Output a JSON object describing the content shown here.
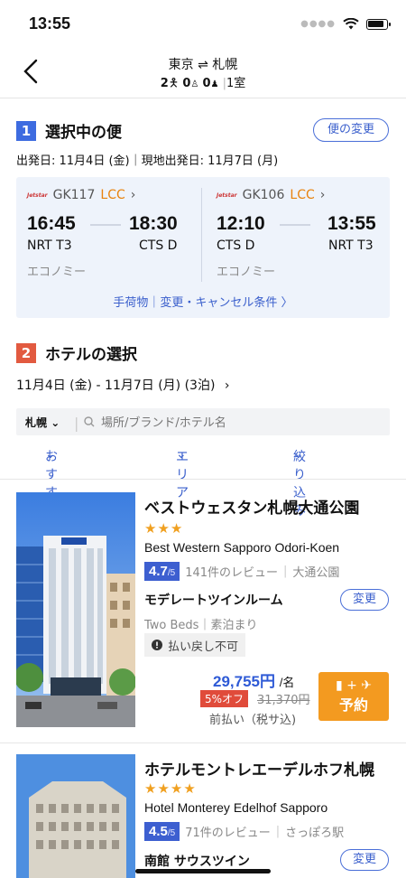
{
  "status": {
    "time": "13:55"
  },
  "header": {
    "route": "東京 ⇌ 札幌",
    "adults": "2",
    "children": "0",
    "infants": "0",
    "rooms": "1室"
  },
  "flights_section": {
    "number": "1",
    "title": "選択中の便",
    "change_label": "便の変更",
    "dates": "出発日: 11月4日 (金)｜現地出発日: 11月7日 (月)",
    "legs": [
      {
        "airline_logo": "Jetstar",
        "flight": "GK117",
        "type": "LCC",
        "dep_time": "16:45",
        "arr_time": "18:30",
        "dep_port": "NRT T3",
        "arr_port": "CTS D",
        "cabin": "エコノミー"
      },
      {
        "airline_logo": "Jetstar",
        "flight": "GK106",
        "type": "LCC",
        "dep_time": "12:10",
        "arr_time": "13:55",
        "dep_port": "CTS D",
        "arr_port": "NRT T3",
        "cabin": "エコノミー"
      }
    ],
    "conditions_link": "手荷物｜変更・キャンセル条件 〉"
  },
  "hotel_section": {
    "number": "2",
    "title": "ホテルの選択",
    "stay_dates": "11月4日 (金) - 11月7日 (月) (3泊)",
    "city": "札幌",
    "search_placeholder": "場所/ブランド/ホテル名",
    "sort": {
      "recommended": "おすすめ",
      "area": "エリア",
      "filter": "絞り込み"
    }
  },
  "hotels": [
    {
      "name": "ベストウェスタン札幌大通公園",
      "stars": "★★★",
      "name_en": "Best Western Sapporo Odori-Koen",
      "score": "4.7",
      "score_max": "/5",
      "reviews": "141件のレビュー",
      "area": "大通公園",
      "room": "モデレートツインルーム",
      "change_label": "変更",
      "room_detail": "Two Beds｜素泊まり",
      "refund": "払い戻し不可",
      "price": "29,755円",
      "price_unit": "/名",
      "discount": "5%オフ",
      "old_price": "31,370円",
      "tax_note": "前払い（税サ込)",
      "book_label": "予約"
    },
    {
      "name": "ホテルモントレエーデルホフ札幌",
      "stars": "★★★★",
      "name_en": "Hotel Monterey Edelhof Sapporo",
      "score": "4.5",
      "score_max": "/5",
      "reviews": "71件のレビュー",
      "area": "さっぽろ駅",
      "room": "南館 サウスツイン",
      "change_label": "変更"
    }
  ],
  "colors": {
    "accent": "#3a5fcc",
    "section1": "#3d6be0",
    "section2": "#e25a40",
    "lcc": "#e8820c",
    "book": "#f39a20",
    "discount": "#e04b3a"
  }
}
